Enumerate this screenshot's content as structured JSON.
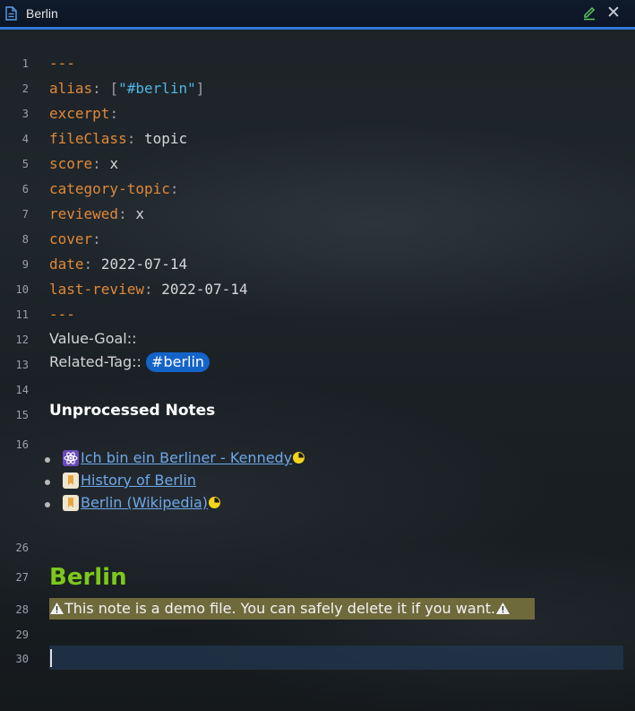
{
  "tab": {
    "title": "Berlin",
    "icons": [
      "file-icon",
      "edit-icon",
      "close-icon"
    ],
    "close_glyph": "✕"
  },
  "line_numbers": [
    "1",
    "2",
    "3",
    "4",
    "5",
    "6",
    "7",
    "8",
    "9",
    "10",
    "11",
    "12",
    "13",
    "14",
    "15",
    "16",
    "26",
    "27",
    "28",
    "29",
    "30"
  ],
  "frontmatter": {
    "open_delim": "---",
    "alias_key": "alias",
    "alias_value": "[\"#berlin\"]",
    "alias_bracket_open": "[",
    "alias_string": "\"#berlin\"",
    "alias_bracket_close": "]",
    "excerpt_key": "excerpt",
    "fileclass_key": "fileClass",
    "fileclass_value": "topic",
    "score_key": "score",
    "score_value": "x",
    "category_key": "category-topic",
    "reviewed_key": "reviewed",
    "reviewed_value": "x",
    "cover_key": "cover",
    "date_key": "date",
    "date_value": "2022-07-14",
    "last_review_key": "last-review",
    "last_review_value": "2022-07-14",
    "close_delim": "---",
    "colon": ":"
  },
  "fields": {
    "value_goal": "Value-Goal::",
    "related_tag_label": "Related-Tag::",
    "related_tag": "#berlin"
  },
  "section_heading": "Unprocessed Notes",
  "notes": [
    {
      "icon": "atom-icon",
      "text": "Ich bin ein Berliner - Kennedy",
      "status": "partial-pie-icon"
    },
    {
      "icon": "bookmark-icon",
      "text": " History of Berlin",
      "status": ""
    },
    {
      "icon": "bookmark-icon",
      "text": " Berlin (Wikipedia)",
      "status": "partial-pie-icon"
    }
  ],
  "heading": "Berlin",
  "warning": "This note is a demo file. You can safely delete it if you want.",
  "colors": {
    "accent": "#2f7ad6",
    "key": "#e0883a",
    "string": "#4fb5e6",
    "tag": "#1463c9",
    "heading": "#7cc81c",
    "link": "#6fa7e8",
    "warning_bg": "#6f6a3c"
  }
}
